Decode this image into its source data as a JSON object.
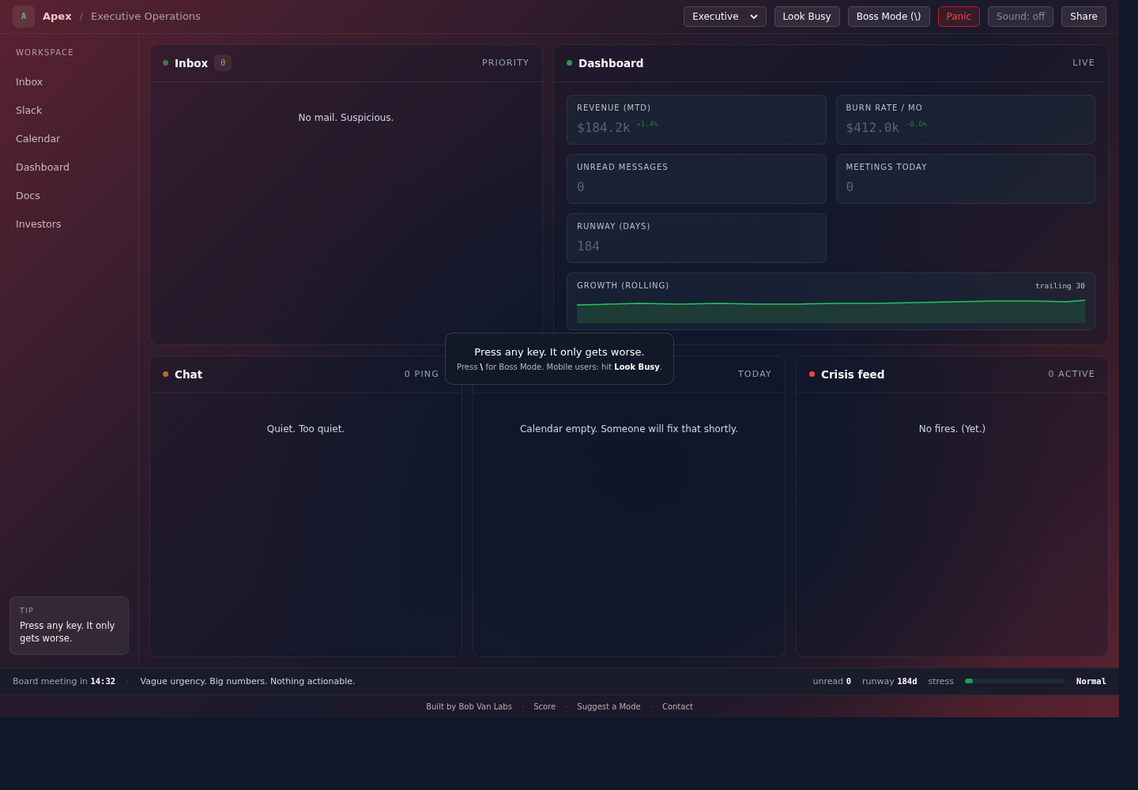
{
  "header": {
    "logo": "A",
    "brand": "Apex",
    "separator": "/",
    "title": "Executive Operations",
    "controls": [
      {
        "kind": "select",
        "label": "Executive"
      },
      {
        "kind": "button",
        "label": "Look Busy"
      },
      {
        "kind": "button",
        "label": "Boss Mode (\\)"
      },
      {
        "kind": "danger",
        "label": "Panic"
      },
      {
        "kind": "muted",
        "label": "Sound: off"
      },
      {
        "kind": "button",
        "label": "Share"
      }
    ]
  },
  "sidebar": {
    "heading": "WORKSPACE",
    "items": [
      "Inbox",
      "Slack",
      "Calendar",
      "Dashboard",
      "Docs",
      "Investors"
    ],
    "tip": {
      "label": "TIP",
      "text": "Press any key. It only gets worse."
    }
  },
  "inbox": {
    "title": "Inbox",
    "color": "#3f7a4a",
    "count": "0",
    "meta": "PRIORITY",
    "empty": "No mail. Suspicious."
  },
  "dashboard": {
    "title": "Dashboard",
    "color": "#22a050",
    "meta": "LIVE",
    "metrics": [
      {
        "label": "REVENUE (MTD)",
        "value": "$184.2k",
        "delta": "+1.4%"
      },
      {
        "label": "BURN RATE / MO",
        "value": "$412.0k",
        "delta": "-0.6%"
      },
      {
        "label": "UNREAD MESSAGES",
        "value": "0"
      },
      {
        "label": "MEETINGS TODAY",
        "value": "0"
      },
      {
        "label": "RUNWAY (DAYS)",
        "value": "184"
      }
    ],
    "growth": {
      "label": "GROWTH (ROLLING)",
      "note": "trailing 30"
    }
  },
  "chat": {
    "title": "Chat",
    "color": "#a8741f",
    "meta": "0 PING",
    "empty": "Quiet. Too quiet."
  },
  "calendar": {
    "meta": "TODAY",
    "empty": "Calendar empty. Someone will fix that shortly."
  },
  "crisis": {
    "title": "Crisis feed",
    "color": "#ef4444",
    "meta": "0 ACTIVE",
    "empty": "No fires. (Yet.)"
  },
  "toast": {
    "title": "Press any key. It only gets worse.",
    "text": "Press **\\** for Boss Mode. Mobile users: hit **Look Busy**."
  },
  "status_bar": {
    "countdown": "Board meeting in **14:32**",
    "separator": "·",
    "message": "Vague urgency. Big numbers. Nothing actionable.",
    "unread": "unread **0**",
    "runway": "runway **184d**",
    "stress_label": "stress",
    "stress": {
      "level": 0.08
    },
    "stress_value": "Normal"
  },
  "footer": {
    "links": [
      "Built by Bob Van Labs",
      "Score",
      "Suggest a Mode",
      "Contact"
    ],
    "separator": "·"
  }
}
